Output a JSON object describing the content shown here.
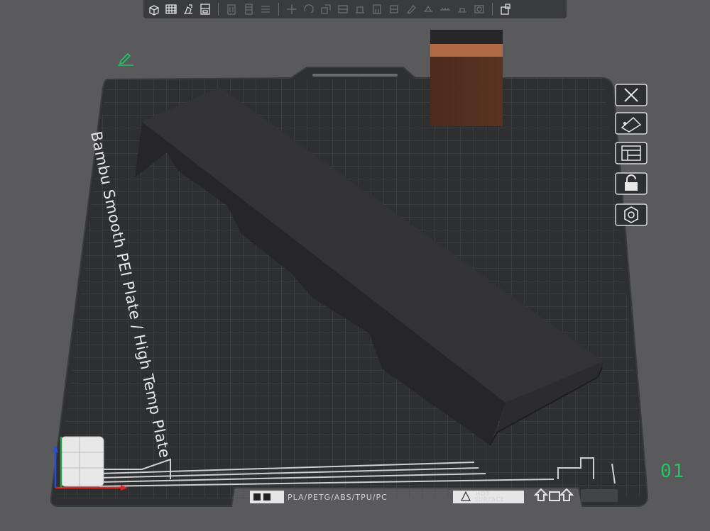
{
  "plate": {
    "label": "Bambu Smooth PEI Plate / High Temp Plate",
    "filament_types": "PLA/PETG/ABS/TPU/PC",
    "hot_surface_line1": "HOT",
    "hot_surface_line2": "SURFACE",
    "number": "01"
  },
  "toolbar": {
    "left_group": [
      "add-object-icon",
      "arrange-grid-icon",
      "auto-orient-icon",
      "split-parts-icon"
    ],
    "disabled_group": [
      "delete-icon",
      "copy-icon",
      "layers-icon"
    ],
    "edit_group": [
      "move-icon",
      "rotate-icon",
      "scale-icon",
      "cut-icon",
      "lay-on-face-icon",
      "support-paint-icon",
      "seam-paint-icon",
      "color-paint-icon",
      "text-emboss-icon",
      "measure-icon",
      "assembly-icon",
      "boolean-icon"
    ],
    "right_group": [
      "view-settings-icon"
    ]
  },
  "sidebar": {
    "items": [
      "close-icon",
      "auto-arrange-icon",
      "plate-layout-icon",
      "lock-icon",
      "settings-hex-icon"
    ]
  },
  "colors": {
    "background": "#5a5a5c",
    "plate": "#2e2f31",
    "grid": "#4a4b4e",
    "plate_number": "#22c55e",
    "object_dark": "#2a2a2b",
    "object_brown": "#5a3020"
  }
}
